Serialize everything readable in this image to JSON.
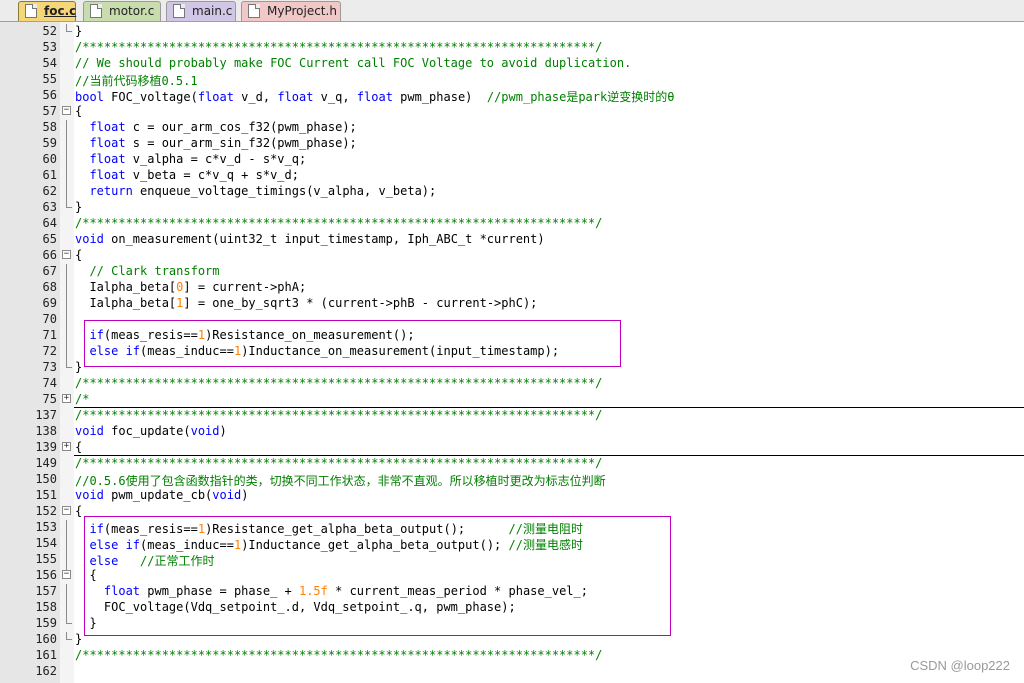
{
  "tabs": [
    {
      "label": "foc.c",
      "active": true
    },
    {
      "label": "motor.c",
      "active": false
    },
    {
      "label": "main.c",
      "active": false
    },
    {
      "label": "MyProject.h",
      "active": false
    }
  ],
  "editor": {
    "lines": [
      {
        "n": "52",
        "fold": "end",
        "sep": false,
        "parts": [
          [
            "p",
            "}"
          ]
        ]
      },
      {
        "n": "53",
        "fold": "",
        "sep": false,
        "parts": [
          [
            "c",
            "/***********************************************************************/"
          ]
        ]
      },
      {
        "n": "54",
        "fold": "",
        "sep": false,
        "parts": [
          [
            "c",
            "// We should probably make FOC Current call FOC Voltage to avoid duplication."
          ]
        ]
      },
      {
        "n": "55",
        "fold": "",
        "sep": false,
        "parts": [
          [
            "c",
            "//当前代码移植0.5.1"
          ]
        ]
      },
      {
        "n": "56",
        "fold": "",
        "sep": false,
        "parts": [
          [
            "k",
            "bool"
          ],
          [
            "p",
            " FOC_voltage("
          ],
          [
            "k",
            "float"
          ],
          [
            "p",
            " v_d, "
          ],
          [
            "k",
            "float"
          ],
          [
            "p",
            " v_q, "
          ],
          [
            "k",
            "float"
          ],
          [
            "p",
            " pwm_phase)  "
          ],
          [
            "c",
            "//pwm_phase是park逆变换时的θ"
          ]
        ]
      },
      {
        "n": "57",
        "fold": "start",
        "sep": false,
        "parts": [
          [
            "p",
            "{"
          ]
        ]
      },
      {
        "n": "58",
        "fold": "line",
        "sep": false,
        "parts": [
          [
            "p",
            "  "
          ],
          [
            "k",
            "float"
          ],
          [
            "p",
            " c = our_arm_cos_f32(pwm_phase);"
          ]
        ]
      },
      {
        "n": "59",
        "fold": "line",
        "sep": false,
        "parts": [
          [
            "p",
            "  "
          ],
          [
            "k",
            "float"
          ],
          [
            "p",
            " s = our_arm_sin_f32(pwm_phase);"
          ]
        ]
      },
      {
        "n": "60",
        "fold": "line",
        "sep": false,
        "parts": [
          [
            "p",
            "  "
          ],
          [
            "k",
            "float"
          ],
          [
            "p",
            " v_alpha = c*v_d - s*v_q;"
          ]
        ]
      },
      {
        "n": "61",
        "fold": "line",
        "sep": false,
        "parts": [
          [
            "p",
            "  "
          ],
          [
            "k",
            "float"
          ],
          [
            "p",
            " v_beta = c*v_q + s*v_d;"
          ]
        ]
      },
      {
        "n": "62",
        "fold": "line",
        "sep": false,
        "parts": [
          [
            "p",
            "  "
          ],
          [
            "k",
            "return"
          ],
          [
            "p",
            " enqueue_voltage_timings(v_alpha, v_beta);"
          ]
        ]
      },
      {
        "n": "63",
        "fold": "end",
        "sep": false,
        "parts": [
          [
            "p",
            "}"
          ]
        ]
      },
      {
        "n": "64",
        "fold": "",
        "sep": false,
        "parts": [
          [
            "c",
            "/***********************************************************************/"
          ]
        ]
      },
      {
        "n": "65",
        "fold": "",
        "sep": false,
        "parts": [
          [
            "k",
            "void"
          ],
          [
            "p",
            " on_measurement(uint32_t input_timestamp, Iph_ABC_t *current)"
          ]
        ]
      },
      {
        "n": "66",
        "fold": "start",
        "sep": false,
        "parts": [
          [
            "p",
            "{"
          ]
        ]
      },
      {
        "n": "67",
        "fold": "line",
        "sep": false,
        "parts": [
          [
            "p",
            "  "
          ],
          [
            "c",
            "// Clark transform"
          ]
        ]
      },
      {
        "n": "68",
        "fold": "line",
        "sep": false,
        "parts": [
          [
            "p",
            "  Ialpha_beta["
          ],
          [
            "n",
            "0"
          ],
          [
            "p",
            "] = current->phA;"
          ]
        ]
      },
      {
        "n": "69",
        "fold": "line",
        "sep": false,
        "parts": [
          [
            "p",
            "  Ialpha_beta["
          ],
          [
            "n",
            "1"
          ],
          [
            "p",
            "] = one_by_sqrt3 * (current->phB - current->phC);"
          ]
        ]
      },
      {
        "n": "70",
        "fold": "line",
        "sep": false,
        "parts": [
          [
            "p",
            ""
          ]
        ]
      },
      {
        "n": "71",
        "fold": "line",
        "sep": false,
        "parts": [
          [
            "p",
            "  "
          ],
          [
            "k",
            "if"
          ],
          [
            "p",
            "(meas_resis=="
          ],
          [
            "n",
            "1"
          ],
          [
            "p",
            ")Resistance_on_measurement();"
          ]
        ]
      },
      {
        "n": "72",
        "fold": "line",
        "sep": false,
        "parts": [
          [
            "p",
            "  "
          ],
          [
            "k",
            "else if"
          ],
          [
            "p",
            "(meas_induc=="
          ],
          [
            "n",
            "1"
          ],
          [
            "p",
            ")Inductance_on_measurement(input_timestamp);"
          ]
        ]
      },
      {
        "n": "73",
        "fold": "end",
        "sep": false,
        "parts": [
          [
            "p",
            "}"
          ]
        ]
      },
      {
        "n": "74",
        "fold": "",
        "sep": false,
        "parts": [
          [
            "c",
            "/***********************************************************************/"
          ]
        ]
      },
      {
        "n": "75",
        "fold": "plus",
        "sep": true,
        "parts": [
          [
            "c",
            "/*"
          ]
        ]
      },
      {
        "n": "137",
        "fold": "",
        "sep": false,
        "parts": [
          [
            "c",
            "/***********************************************************************/"
          ]
        ]
      },
      {
        "n": "138",
        "fold": "",
        "sep": false,
        "parts": [
          [
            "k",
            "void"
          ],
          [
            "p",
            " foc_update("
          ],
          [
            "k",
            "void"
          ],
          [
            "p",
            ")"
          ]
        ]
      },
      {
        "n": "139",
        "fold": "plus",
        "sep": true,
        "parts": [
          [
            "p",
            "{"
          ]
        ]
      },
      {
        "n": "149",
        "fold": "",
        "sep": false,
        "parts": [
          [
            "c",
            "/***********************************************************************/"
          ]
        ]
      },
      {
        "n": "150",
        "fold": "",
        "sep": false,
        "parts": [
          [
            "c",
            "//0.5.6使用了包含函数指针的类，切换不同工作状态，非常不直观。所以移植时更改为标志位判断"
          ]
        ]
      },
      {
        "n": "151",
        "fold": "",
        "sep": false,
        "parts": [
          [
            "k",
            "void"
          ],
          [
            "p",
            " pwm_update_cb("
          ],
          [
            "k",
            "void"
          ],
          [
            "p",
            ")"
          ]
        ]
      },
      {
        "n": "152",
        "fold": "start",
        "sep": false,
        "parts": [
          [
            "p",
            "{"
          ]
        ]
      },
      {
        "n": "153",
        "fold": "line",
        "sep": false,
        "parts": [
          [
            "p",
            "  "
          ],
          [
            "k",
            "if"
          ],
          [
            "p",
            "(meas_resis=="
          ],
          [
            "n",
            "1"
          ],
          [
            "p",
            ")Resistance_get_alpha_beta_output();      "
          ],
          [
            "c",
            "//测量电阻时"
          ]
        ]
      },
      {
        "n": "154",
        "fold": "line",
        "sep": false,
        "parts": [
          [
            "p",
            "  "
          ],
          [
            "k",
            "else if"
          ],
          [
            "p",
            "(meas_induc=="
          ],
          [
            "n",
            "1"
          ],
          [
            "p",
            ")Inductance_get_alpha_beta_output(); "
          ],
          [
            "c",
            "//测量电感时"
          ]
        ]
      },
      {
        "n": "155",
        "fold": "line",
        "sep": false,
        "parts": [
          [
            "p",
            "  "
          ],
          [
            "k",
            "else"
          ],
          [
            "p",
            "   "
          ],
          [
            "c",
            "//正常工作时"
          ]
        ]
      },
      {
        "n": "156",
        "fold": "start2",
        "sep": false,
        "parts": [
          [
            "p",
            "  {"
          ]
        ]
      },
      {
        "n": "157",
        "fold": "line",
        "sep": false,
        "parts": [
          [
            "p",
            "    "
          ],
          [
            "k",
            "float"
          ],
          [
            "p",
            " pwm_phase = phase_ + "
          ],
          [
            "n",
            "1.5f"
          ],
          [
            "p",
            " * current_meas_period * phase_vel_;"
          ]
        ]
      },
      {
        "n": "158",
        "fold": "line",
        "sep": false,
        "parts": [
          [
            "p",
            "    FOC_voltage(Vdq_setpoint_.d, Vdq_setpoint_.q, pwm_phase);"
          ]
        ]
      },
      {
        "n": "159",
        "fold": "end",
        "sep": false,
        "parts": [
          [
            "p",
            "  }"
          ]
        ]
      },
      {
        "n": "160",
        "fold": "end",
        "sep": false,
        "parts": [
          [
            "p",
            "}"
          ]
        ]
      },
      {
        "n": "161",
        "fold": "",
        "sep": false,
        "parts": [
          [
            "c",
            "/***********************************************************************/"
          ]
        ]
      },
      {
        "n": "162",
        "fold": "",
        "sep": false,
        "parts": [
          [
            "p",
            ""
          ]
        ]
      }
    ]
  },
  "colors": {
    "keyword": "#0000ff",
    "comment": "#008000",
    "number": "#ff8000",
    "highlight_box": "#c000c0"
  },
  "watermark": "CSDN @loop222"
}
